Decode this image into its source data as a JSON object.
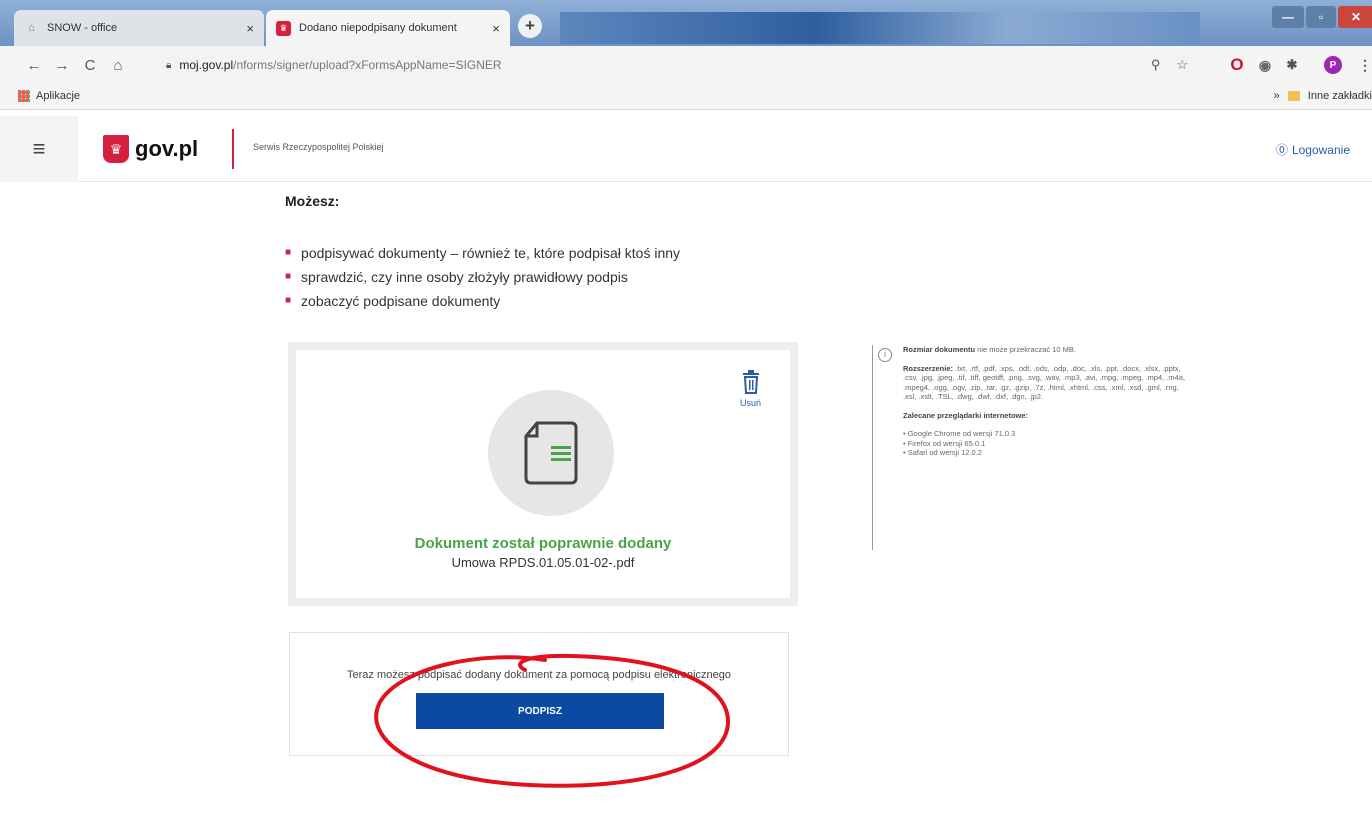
{
  "browser": {
    "tabs": [
      {
        "title": "SNOW - office",
        "close": "×"
      },
      {
        "title": "Dodano niepodpisany dokument",
        "close": "×"
      }
    ],
    "new_tab": "+",
    "window_controls": {
      "minimize": "—",
      "maximize": "▫",
      "close": "✕"
    },
    "nav": {
      "back": "←",
      "forward": "→",
      "reload": "C",
      "home": "⌂"
    },
    "url_host": "moj.gov.pl",
    "url_path": "/nforms/signer/upload?xFormsAppName=SIGNER",
    "omnibox_icons": {
      "zoom": "⚲",
      "star": "☆"
    },
    "extensions": {
      "opera": "O",
      "shield": "◉",
      "puzzle": "✱",
      "avatar": "P",
      "menu": "⋮"
    },
    "bookmarks": {
      "apps": "Aplikacje",
      "other": "Inne zakładki",
      "more": "»"
    }
  },
  "site": {
    "menu_icon": "≡",
    "logo_text": "gov.pl",
    "tagline": "Serwis Rzeczypospolitej Polskiej",
    "login": "Logowanie",
    "login_icon": "⓪"
  },
  "content": {
    "can_title": "Możesz:",
    "bullets": [
      "podpisywać dokumenty – również te, które podpisał ktoś inny",
      "sprawdzić, czy inne osoby złożyły prawidłowy podpis",
      "zobaczyć podpisane dokumenty"
    ],
    "upload": {
      "delete_label": "Usuń",
      "success_title": "Dokument został poprawnie dodany",
      "filename": "Umowa RPDS.01.05.01-02-.pdf"
    },
    "info": {
      "size_label": "Rozmiar dokumentu",
      "size_text": "nie może przekraczać 10 MB.",
      "ext_label": "Rozszerzenie:",
      "ext_text": ".txt, .rtf, .pdf, .xps, .odt, .ods, .odp, .doc, .xls, .ppt, .docx, .xlsx, .pptx, .csv, .jpg, .jpeg, .tif, .tiff, geotiff, .png, .svg, .wav, .mp3, .avi, .mpg, .mpeg, .mp4, .m4a, .mpeg4, .ogg, .ogv, .zip, .tar, .gz, .gzip, .7z, .html, .xhtml, .css, .xml, .xsd, .gml, .rng, .xsl, .xslt, .TSL, .dwg, .dwf, .dxf, .dgn, .jp2.",
      "browsers_label": "Zalecane przeglądarki internetowe:",
      "browsers": [
        "• Google Chrome od wersji 71.0.3",
        "• Firefox od wersji 65.0.1",
        "• Safari od wersji 12.0.2"
      ]
    },
    "sign": {
      "text": "Teraz możesz podpisać dodany dokument za pomocą podpisu elektronicznego",
      "button": "PODPISZ"
    }
  },
  "colors": {
    "accent_red": "#d4213d",
    "primary_blue": "#0b4aa2",
    "success_green": "#4aa24a",
    "annotation_red": "#e0121e"
  }
}
